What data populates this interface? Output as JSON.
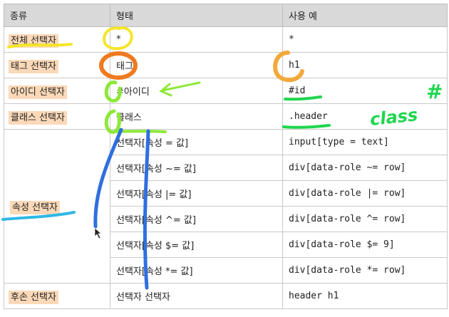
{
  "table": {
    "headers": [
      "종류",
      "형태",
      "사용 예"
    ],
    "rows": [
      {
        "kind": "전체 선택자",
        "form": "*",
        "example": "*"
      },
      {
        "kind": "태그 선택자",
        "form": "태그",
        "example": "h1"
      },
      {
        "kind": "아이디 선택자",
        "form": "#아이디",
        "example": "#id"
      },
      {
        "kind": "클래스 선택자",
        "form": "클래스",
        "example": ".header"
      },
      {
        "kind": "속성 선택자",
        "form": "선택자[속성 = 값]",
        "example": "input[type = text]"
      },
      {
        "kind": "",
        "form": "선택자[속성 ~= 값]",
        "example": "div[data-role ~= row]"
      },
      {
        "kind": "",
        "form": "선택자[속성 |= 값]",
        "example": "div[data-role |= row]"
      },
      {
        "kind": "",
        "form": "선택자[속성 ^= 값]",
        "example": "div[data-role ^= row]"
      },
      {
        "kind": "",
        "form": "선택자[속성 $= 값]",
        "example": "div[data-role $= 9]"
      },
      {
        "kind": "",
        "form": "선택자[속성 *= 값]",
        "example": "div[data-role *= row]"
      },
      {
        "kind": "후손 선택자",
        "form": "선택자 선택자",
        "example": "header h1"
      }
    ]
  },
  "annotations": {
    "class_note": "class",
    "hash_note": "#"
  },
  "colors": {
    "header_bg": "#d9d9d9",
    "kind_highlight": "#fbd9b8",
    "ink_yellow": "#f5e52a",
    "ink_orange": "#f07a1f",
    "ink_gold": "#f2a93b",
    "ink_green": "#1fd64e",
    "ink_lime": "#8ee83a",
    "ink_blue": "#2f6fe0",
    "ink_cyan": "#2fb8e6"
  }
}
